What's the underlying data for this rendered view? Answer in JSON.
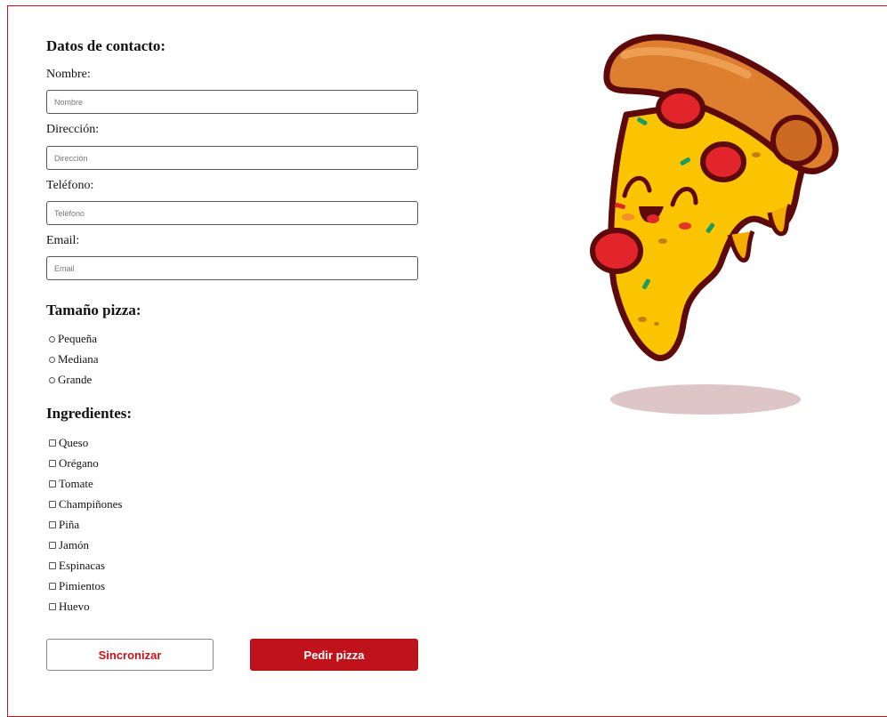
{
  "contact": {
    "heading": "Datos de contacto:",
    "fields": [
      {
        "label": "Nombre:",
        "placeholder": "Nombre"
      },
      {
        "label": "Dirección:",
        "placeholder": "Dirección"
      },
      {
        "label": "Teléfono:",
        "placeholder": "Teléfono"
      },
      {
        "label": "Email:",
        "placeholder": "Email"
      }
    ]
  },
  "size": {
    "heading": "Tamaño pizza:",
    "options": [
      "Pequeña",
      "Mediana",
      "Grande"
    ]
  },
  "ingredients": {
    "heading": "Ingredientes:",
    "options": [
      "Queso",
      "Orégano",
      "Tomate",
      "Champiñones",
      "Piña",
      "Jamón",
      "Espinacas",
      "Pimientos",
      "Huevo"
    ]
  },
  "buttons": {
    "sync_label": "Sincronizar",
    "order_label": "Pedir pizza"
  },
  "colors": {
    "accent": "#c0121a",
    "border": "#c8121c"
  },
  "illustration": {
    "icon": "pizza-slice-mascot-icon"
  }
}
